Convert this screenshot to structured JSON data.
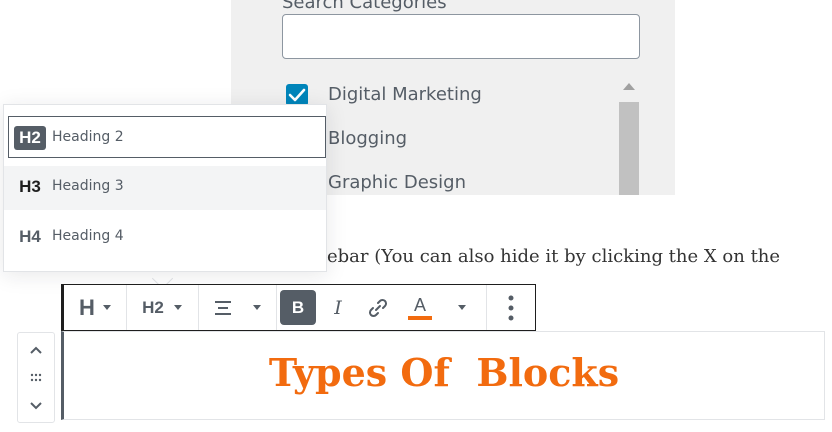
{
  "categories": {
    "search_label": "Search Categories",
    "search_value": "",
    "items": [
      {
        "label": "Digital Marketing",
        "checked": true
      },
      {
        "label": "Blogging",
        "checked": false
      },
      {
        "label": "Graphic Design",
        "checked": false
      }
    ]
  },
  "paragraph": {
    "text": "ebar (You can also hide it by clicking the X on the"
  },
  "heading_dropdown": {
    "items": [
      {
        "icon": "H2",
        "label": "Heading 2",
        "selected": true
      },
      {
        "icon": "H3",
        "label": "Heading 3",
        "selected": false
      },
      {
        "icon": "H4",
        "label": "Heading 4",
        "selected": false
      }
    ]
  },
  "toolbar": {
    "block_type_icon": "H",
    "heading_level": "H2",
    "bold_label": "B",
    "italic_label": "I",
    "text_color_label": "A",
    "text_color": "#f26b0f"
  },
  "block": {
    "heading_text": "Types Of  Blocks",
    "heading_color": "#f26b0f"
  },
  "colors": {
    "accent": "#0085ba",
    "toolbar_active": "#555d66"
  }
}
